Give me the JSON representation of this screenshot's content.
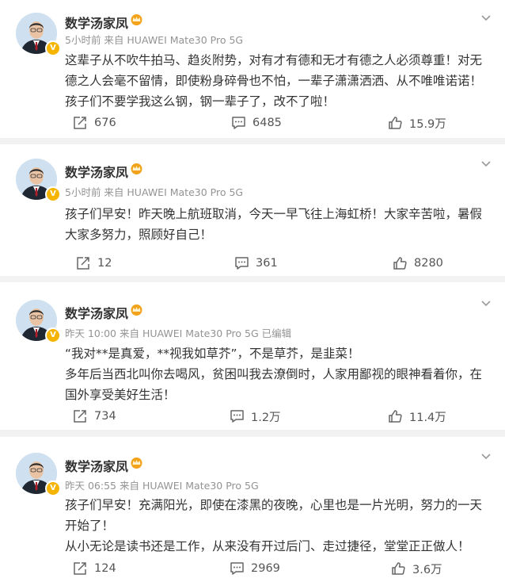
{
  "posts": [
    {
      "author": "数学汤家凤",
      "meta": "5小时前  来自 HUAWEI Mate30 Pro 5G",
      "text": "这辈子从不吹牛拍马、趋炎附势，对有才有德和无才有德之人必须尊重！对无德之人会毫不留情，即使粉身碎骨也不怕，一辈子潇潇洒洒、从不唯唯诺诺！\n孩子们不要学我这么钢，钢一辈子了，改不了啦！",
      "repost": "676",
      "comment": "6485",
      "like": "15.9万"
    },
    {
      "author": "数学汤家凤",
      "meta": "5小时前  来自 HUAWEI Mate30 Pro 5G",
      "text": "孩子们早安！昨天晚上航班取消，今天一早飞往上海虹桥！大家辛苦啦，暑假大家多努力，照顾好自己！",
      "repost": "12",
      "comment": "361",
      "like": "8280"
    },
    {
      "author": "数学汤家凤",
      "meta": "昨天 10:00  来自 HUAWEI Mate30 Pro 5G 已编辑",
      "text": "“我对**是真爱，**视我如草芥”，不是草芥，是韭菜！\n多年后当西北叫你去喝风，贫困叫我去潦倒时，人家用鄙视的眼神看着你，在国外享受美好生活！",
      "repost": "734",
      "comment": "1.2万",
      "like": "11.4万"
    },
    {
      "author": "数学汤家凤",
      "meta": "昨天 06:55  来自 HUAWEI Mate30 Pro 5G",
      "text": "孩子们早安！充满阳光，即使在漆黑的夜晚，心里也是一片光明，努力的一天开始了！\n从小无论是读书还是工作，从来没有开过后门、走过捷径，堂堂正正做人！",
      "repost": "124",
      "comment": "2969",
      "like": "3.6万"
    }
  ],
  "icons": {
    "verified": "verified-badge-icon",
    "crown": "crown-badge-icon",
    "more": "chevron-down-icon",
    "repost": "repost-icon",
    "comment": "comment-icon",
    "like": "like-icon"
  },
  "colors": {
    "background": "#f2f2f2",
    "card": "#ffffff",
    "meta": "#939393",
    "verified": "#f5b400",
    "crown": "#f3a21b"
  }
}
